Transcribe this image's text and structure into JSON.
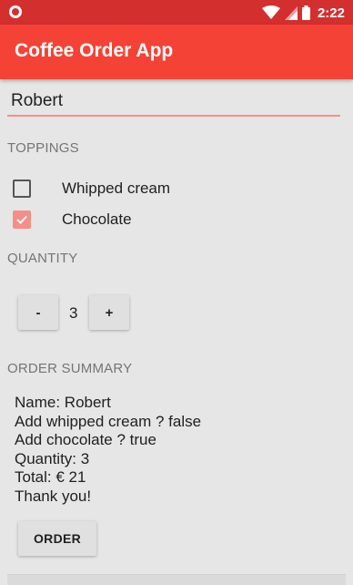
{
  "status_bar": {
    "time": "2:22",
    "icons": [
      "app-notification-icon",
      "wifi-icon",
      "cell-signal-icon",
      "battery-icon"
    ],
    "color": "#d32f2f"
  },
  "app_bar": {
    "title": "Coffee Order App",
    "color": "#f44336"
  },
  "name_field": {
    "value": "Robert",
    "accent": "#f48f87"
  },
  "toppings": {
    "label": "TOPPINGS",
    "items": [
      {
        "label": "Whipped cream",
        "checked": false
      },
      {
        "label": "Chocolate",
        "checked": true
      }
    ]
  },
  "quantity": {
    "label": "QUANTITY",
    "decrement_label": "-",
    "value": "3",
    "increment_label": "+"
  },
  "order_summary": {
    "label": "ORDER SUMMARY",
    "lines": [
      "Name: Robert",
      "Add whipped cream ? false",
      "Add chocolate ? true",
      "Quantity: 3",
      "Total: € 21",
      "Thank you!"
    ]
  },
  "order_button": {
    "label": "ORDER"
  }
}
